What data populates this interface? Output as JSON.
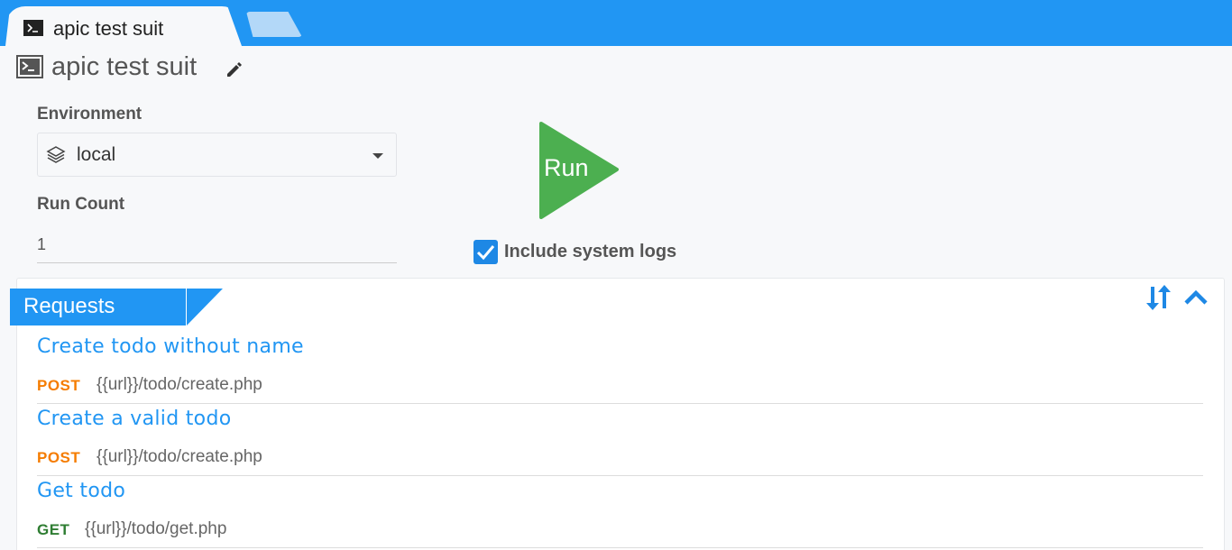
{
  "tabs": [
    {
      "label": "apic test suit",
      "icon": "terminal-icon"
    }
  ],
  "header": {
    "title": "apic test suit",
    "icon": "terminal-icon",
    "edit_icon": "pencil-icon"
  },
  "form": {
    "environment_label": "Environment",
    "environment_value": "local",
    "environment_icon": "layers-icon",
    "run_count_label": "Run Count",
    "run_count_value": "1"
  },
  "run_button": {
    "label": "Run",
    "color": "#4caf50"
  },
  "system_logs": {
    "label": "Include system logs",
    "checked": true
  },
  "requests": {
    "title": "Requests",
    "items": [
      {
        "name": "Create todo without name",
        "method": "POST",
        "url": "{{url}}/todo/create.php"
      },
      {
        "name": "Create a valid todo",
        "method": "POST",
        "url": "{{url}}/todo/create.php"
      },
      {
        "name": "Get todo",
        "method": "GET",
        "url": "{{url}}/todo/get.php"
      }
    ]
  },
  "colors": {
    "accent": "#2196f3",
    "run_green": "#4caf50",
    "post": "#f57c00",
    "get": "#2e7d32"
  }
}
